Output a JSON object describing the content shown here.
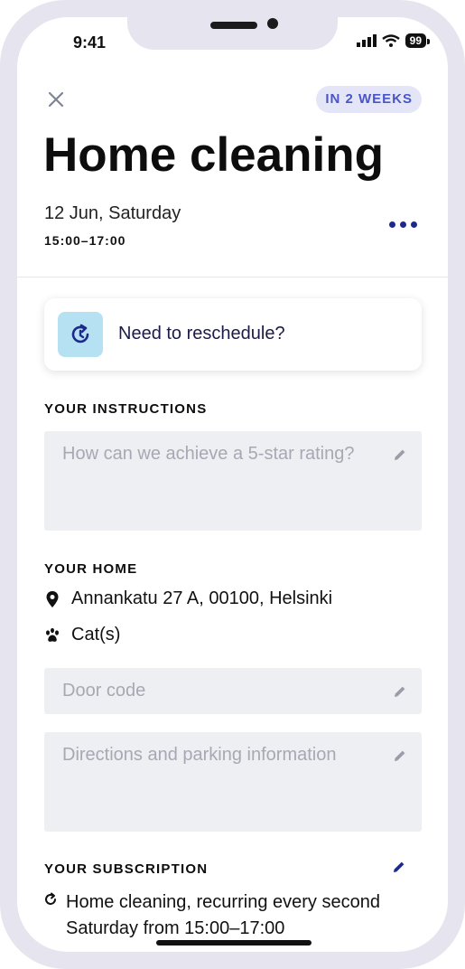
{
  "status_bar": {
    "time": "9:41",
    "battery": "99"
  },
  "header": {
    "badge": "IN 2 WEEKS",
    "title": "Home cleaning",
    "date": "12 Jun, Saturday",
    "hours": "15:00–17:00"
  },
  "reschedule": {
    "label": "Need to reschedule?"
  },
  "instructions": {
    "heading": "YOUR INSTRUCTIONS",
    "placeholder": "How can we achieve a 5-star rating?"
  },
  "home": {
    "heading": "YOUR HOME",
    "address": "Annankatu 27 A, 00100, Helsinki",
    "pets": "Cat(s)",
    "door_code_placeholder": "Door code",
    "directions_placeholder": "Directions and parking information"
  },
  "subscription": {
    "heading": "YOUR SUBSCRIPTION",
    "text": "Home cleaning, recurring every second Saturday from 15:00–17:00"
  },
  "colors": {
    "accent": "#1e2a8a",
    "badge_bg": "#e4e6f7",
    "badge_text": "#4a56c6",
    "icon_bg": "#b5e1f3",
    "field_bg": "#eeeff3"
  }
}
